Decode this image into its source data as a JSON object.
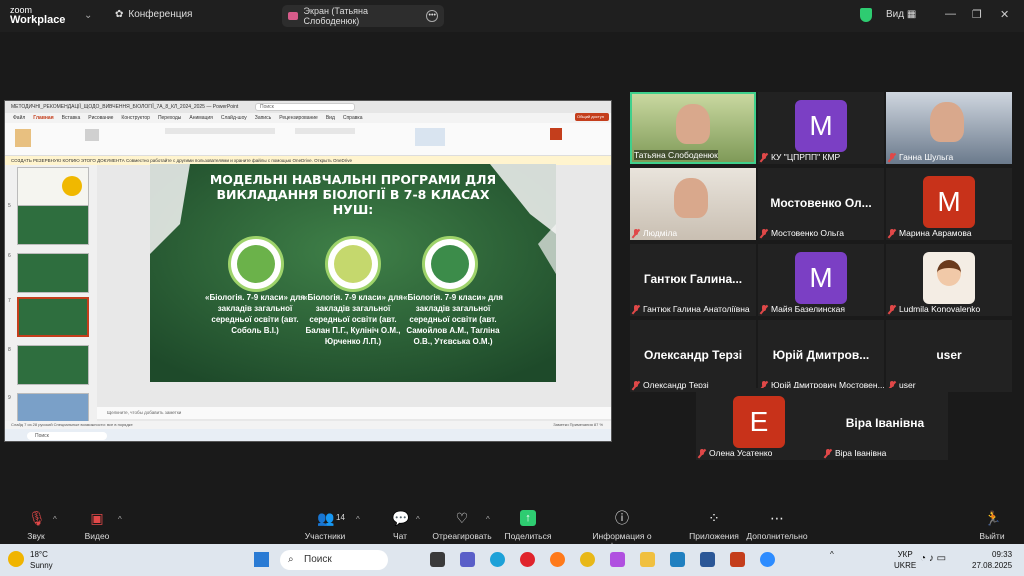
{
  "app": {
    "logo_line1": "zoom",
    "logo_line2": "Workplace",
    "conference_tab": "Конференция"
  },
  "screen_tab": {
    "label": "Экран (Татьяна Слободенюк)"
  },
  "view_button": "Вид",
  "pp": {
    "title": "МЕТОДИЧНІ_РЕКОМЕНДАЦІЇ_ЩОДО_ВИВЧЕННЯ_БІОЛОГІЇ_7А_8_КЛ_2024_2025 — PowerPoint",
    "search_placeholder": "Поиск",
    "menu": [
      "Файл",
      "Главная",
      "Вставка",
      "Рисование",
      "Конструктор",
      "Переходы",
      "Анимация",
      "Слайд-шоу",
      "Запись",
      "Рецензирование",
      "Вид",
      "Справка"
    ],
    "share_label": "Общий доступ",
    "notice": "СОЗДАТЬ РЕЗЕРВНУЮ КОПИЮ ЭТОГО ДОКУМЕНТА  Совместно работайте с другими пользователями и храните файлы с помощью OneDrive.  Открыть OneDrive",
    "notes_placeholder": "Щелкните, чтобы добавить заметки",
    "status": "Слайд 7 из 28   русский   Специальные возможности: все в порядке",
    "status_right": "Заметки   Примечания      87 %",
    "thumb_numbers": [
      "",
      "5",
      "6",
      "7",
      "8",
      "9"
    ]
  },
  "slide": {
    "title_line1": "МОДЕЛЬНІ НАВЧАЛЬНІ ПРОГРАМИ ДЛЯ",
    "title_line2": "ВИКЛАДАННЯ БІОЛОГІЇ В 7-8 КЛАСАХ",
    "title_line3": "НУШ:",
    "book1": "«Біологія. 7-9 класи» для закладів загальної середньої освіти (авт. Соболь В.І.)",
    "book2": "«Біологія. 7-9 класи» для закладів загальної середньої освіти (авт. Балан П.Г., Кулініч О.М., Юрченко Л.П.)",
    "book3": "«Біологія. 7-9 класи» для закладів загальної середньої освіти (авт. Самойлов А.М., Тагліна О.В., Утєвська О.М.)"
  },
  "participants": [
    {
      "name": "Татьяна Слободенюк",
      "type": "video",
      "muted": false
    },
    {
      "name": "КУ \"ЦПРПП\" КМР",
      "type": "avatar",
      "letter": "M",
      "color": "#7b3fc4"
    },
    {
      "name": "Ганна Шульга",
      "type": "video",
      "muted": true
    },
    {
      "name": "Людміла",
      "type": "video",
      "muted": true
    },
    {
      "name": "Мостовенко Ольга",
      "type": "text",
      "big": "Мостовенко  Ол..."
    },
    {
      "name": "Марина Аврамова",
      "type": "avatar",
      "letter": "M",
      "color": "#c8321a"
    },
    {
      "name": "Гантюк Галина Анатоліївна",
      "type": "text",
      "big": "Гантюк  Галина..."
    },
    {
      "name": "Майя Базелинская",
      "type": "avatar",
      "letter": "M",
      "color": "#7b3fc4"
    },
    {
      "name": "Ludmila Konovalenko",
      "type": "cartoon"
    },
    {
      "name": "Олександр Терзі",
      "type": "text",
      "big": "Олександр Терзі"
    },
    {
      "name": "Юрій Дмитрович Мостовен...",
      "type": "text",
      "big": "Юрій  Дмитров..."
    },
    {
      "name": "user",
      "type": "text",
      "big": "user"
    },
    {
      "name": "Олена Усатенко",
      "type": "avatar",
      "letter": "E",
      "color": "#c8321a"
    },
    {
      "name": "Віра Іванівна",
      "type": "text",
      "big": "Віра Іванівна"
    }
  ],
  "toolbar": {
    "audio": "Звук",
    "video": "Видео",
    "participants": "Участники",
    "participants_count": "14",
    "chat": "Чат",
    "react": "Отреагировать",
    "share": "Поделиться",
    "info": "Информация о конференции",
    "apps": "Приложения",
    "more": "Дополнительно",
    "leave": "Выйти"
  },
  "taskbar": {
    "temp": "18°C",
    "weather": "Sunny",
    "search": "Поиск",
    "lang1": "УКР",
    "lang2": "UKRE",
    "time": "09:33",
    "date": "27.08.2025"
  },
  "colors": {
    "accent": "#2ecc71",
    "ppt": "#c43e1c",
    "slide_bg": "#2f6b3b",
    "speaker_border": "#3fd08c"
  }
}
